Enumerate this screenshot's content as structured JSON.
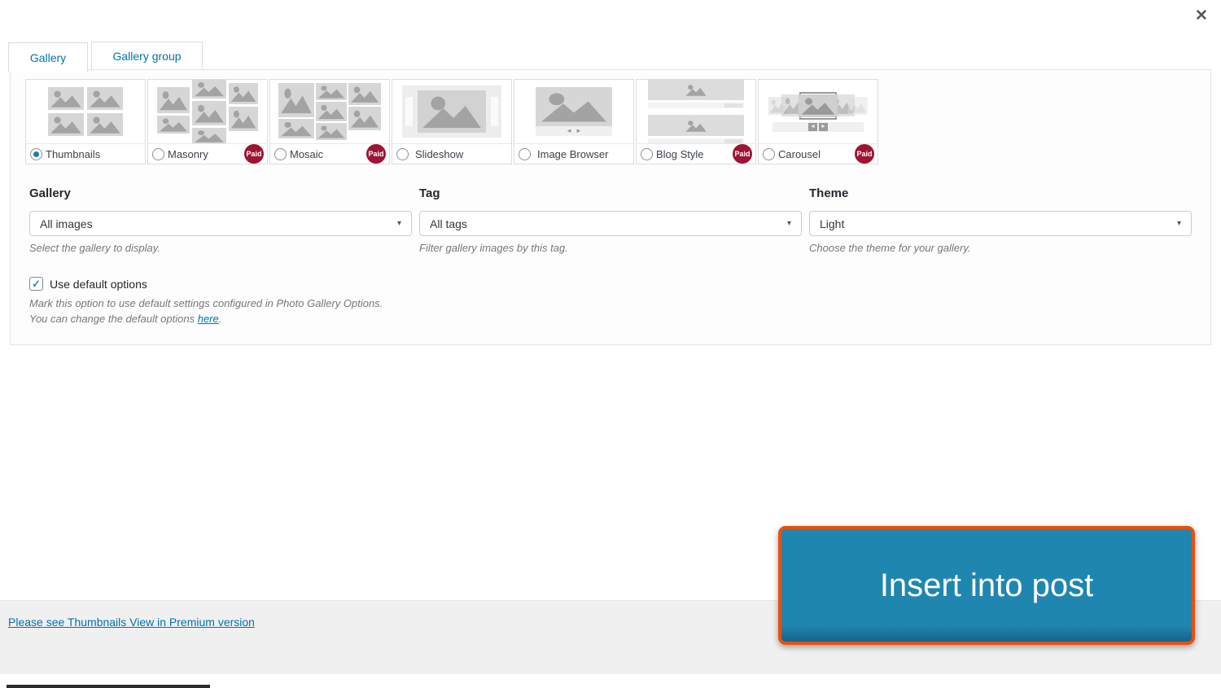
{
  "dialog": {
    "tabs": [
      {
        "label": "Gallery",
        "active": true
      },
      {
        "label": "Gallery group",
        "active": false
      }
    ]
  },
  "icons": {
    "close": "✕",
    "dropdown": "▾",
    "prev": "◄",
    "next": "►",
    "check": "✓"
  },
  "views": {
    "paid_label": "Paid",
    "items": [
      {
        "label": "Thumbnails",
        "selected": true,
        "paid": false
      },
      {
        "label": "Masonry",
        "selected": false,
        "paid": true
      },
      {
        "label": "Mosaic",
        "selected": false,
        "paid": true
      },
      {
        "label": "Slideshow",
        "selected": false,
        "paid": false
      },
      {
        "label": "Image Browser",
        "selected": false,
        "paid": false
      },
      {
        "label": "Blog Style",
        "selected": false,
        "paid": true
      },
      {
        "label": "Carousel",
        "selected": false,
        "paid": true
      }
    ]
  },
  "fields": {
    "gallery": {
      "label": "Gallery",
      "value": "All images",
      "caption": "Select the gallery to display."
    },
    "tag": {
      "label": "Tag",
      "value": "All tags",
      "caption": "Filter gallery images by this tag."
    },
    "theme": {
      "label": "Theme",
      "value": "Light",
      "caption": "Choose the theme for your gallery."
    }
  },
  "default_options": {
    "label": "Use default options",
    "checked": true,
    "note_line1": "Mark this option to use default settings configured in Photo Gallery Options.",
    "note_line2_prefix": "You can change the default options ",
    "note_link": "here",
    "note_suffix": "."
  },
  "footer": {
    "premium_link": "Please see Thumbnails View in Premium version"
  },
  "insert_button": {
    "label": "Insert into post"
  },
  "colors": {
    "accent": "#0073aa",
    "paid_badge": "#9e1432",
    "button_fill": "#1f86b0",
    "button_border": "#e8500f"
  }
}
